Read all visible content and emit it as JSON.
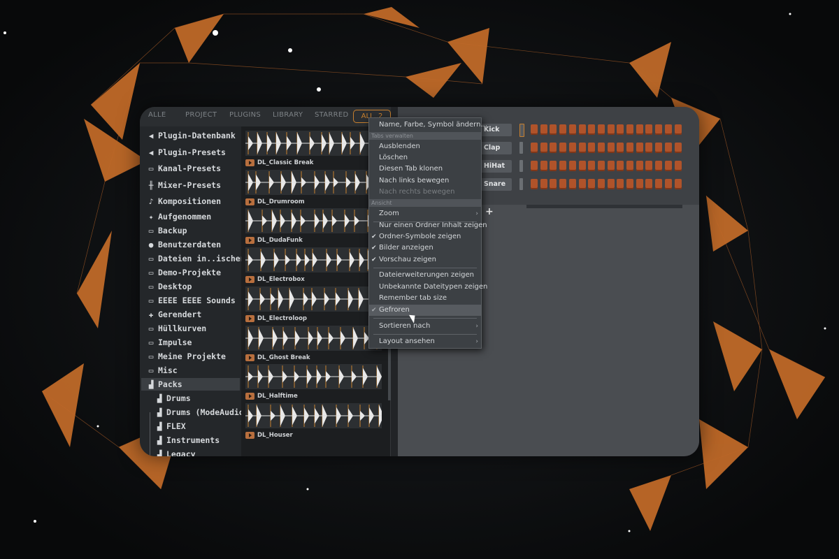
{
  "colors": {
    "accent": "#c8802e",
    "step": "#b0532a",
    "panel": "#34373a"
  },
  "tabs": [
    "ALLE",
    "PROJECT",
    "PLUGINS",
    "LIBRARY",
    "STARRED",
    "ALL..2"
  ],
  "browser": {
    "items": [
      {
        "label": "Plugin-Datenbank",
        "icon": "speaker-icon"
      },
      {
        "label": "Plugin-Presets",
        "icon": "speaker-icon"
      },
      {
        "label": "Kanal-Presets",
        "icon": "channel-icon"
      },
      {
        "label": "Mixer-Presets",
        "icon": "mixer-icon"
      },
      {
        "label": "Kompositionen",
        "icon": "note-icon"
      },
      {
        "label": "Aufgenommen",
        "icon": "record-icon"
      },
      {
        "label": "Backup",
        "icon": "folder-icon"
      },
      {
        "label": "Benutzerdaten",
        "icon": "user-icon"
      },
      {
        "label": "Dateien in..ischenablage",
        "icon": "folder-icon"
      },
      {
        "label": "Demo-Projekte",
        "icon": "folder-icon"
      },
      {
        "label": "Desktop",
        "icon": "folder-icon"
      },
      {
        "label": "EEEE EEEE Sounds",
        "icon": "folder-icon"
      },
      {
        "label": "Gerendert",
        "icon": "render-icon"
      },
      {
        "label": "Hüllkurven",
        "icon": "folder-icon"
      },
      {
        "label": "Impulse",
        "icon": "folder-icon"
      },
      {
        "label": "Meine Projekte",
        "icon": "folder-icon"
      },
      {
        "label": "Misc",
        "icon": "folder-icon"
      },
      {
        "label": "Packs",
        "icon": "pack-icon"
      },
      {
        "label": "Drums",
        "icon": "pack-icon"
      },
      {
        "label": "Drums (ModeAudio)",
        "icon": "pack-icon"
      },
      {
        "label": "FLEX",
        "icon": "pack-icon"
      },
      {
        "label": "Instruments",
        "icon": "pack-icon"
      },
      {
        "label": "Legacy",
        "icon": "pack-icon"
      }
    ]
  },
  "samples": [
    "DL_Classic Break",
    "DL_Drumroom",
    "DL_DudaFunk",
    "DL_Electrobox",
    "DL_Electroloop",
    "DL_Ghost Break",
    "DL_Halftime",
    "DL_Houser"
  ],
  "channel_rack": {
    "channels": [
      "8 Kick",
      "8 Clap",
      "8 HiHat",
      "8 Snare"
    ],
    "add_label": "+"
  },
  "context_menu": {
    "top_item": "Name, Farbe, Symbol ändern...",
    "header_tabs": "Tabs verwalten",
    "tabs_items": [
      "Ausblenden",
      "Löschen",
      "Diesen Tab klonen",
      "Nach links bewegen",
      "Nach rechts bewegen"
    ],
    "header_view": "Ansicht",
    "zoom": "Zoom",
    "view_items": [
      "Nur einen Ordner Inhalt zeigen",
      "Ordner-Symbole zeigen",
      "Bilder anzeigen",
      "Vorschau zeigen"
    ],
    "file_items": [
      "Dateierweiterungen zeigen",
      "Unbekannte Dateitypen zeigen",
      "Remember tab size",
      "Gefroren"
    ],
    "sort": "Sortieren nach",
    "layout": "Layout ansehen"
  }
}
